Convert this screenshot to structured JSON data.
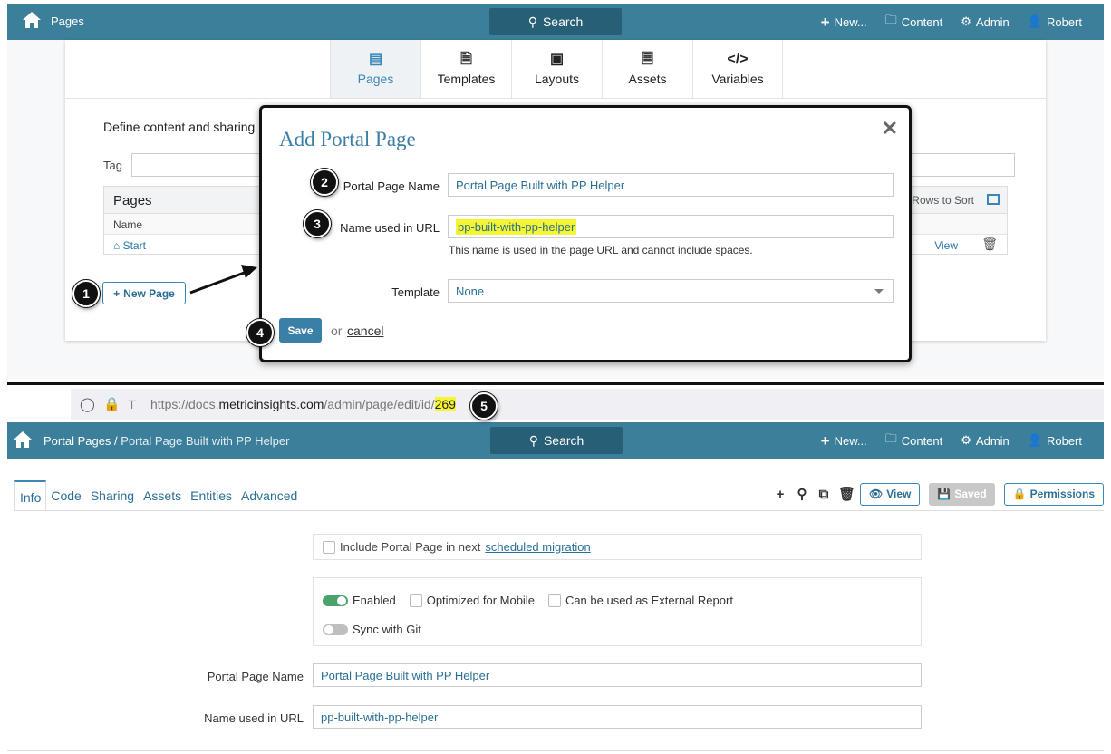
{
  "top": {
    "breadcrumb": "Pages",
    "search_label": "Search",
    "nav": {
      "new": "New...",
      "content": "Content",
      "admin": "Admin",
      "user": "Robert"
    },
    "tabs": [
      {
        "label": "Pages",
        "icon": "pages-icon",
        "active": true
      },
      {
        "label": "Templates",
        "icon": "templates-icon"
      },
      {
        "label": "Layouts",
        "icon": "layouts-icon"
      },
      {
        "label": "Assets",
        "icon": "assets-icon"
      },
      {
        "label": "Variables",
        "icon": "variables-icon"
      }
    ],
    "define_text": "Define content and sharing",
    "tag_label": "Tag",
    "table": {
      "title": "Pages",
      "rows_to_sort": "Rows to Sort",
      "col_name": "Name",
      "row_start": "Start",
      "row_view": "View"
    },
    "new_page_button": "New Page"
  },
  "modal": {
    "title": "Add Portal Page",
    "portal_page_name_label": "Portal Page Name",
    "portal_page_name_value": "Portal Page Built with PP Helper",
    "url_name_label": "Name used in URL",
    "url_name_value": "pp-built-with-pp-helper",
    "url_hint": "This name is used in the page URL and cannot include spaces.",
    "template_label": "Template",
    "template_value": "None",
    "save_label": "Save",
    "or_text": "or",
    "cancel_label": "cancel"
  },
  "callouts": [
    "1",
    "2",
    "3",
    "4",
    "5"
  ],
  "browser": {
    "url_prefix": "https://docs.",
    "url_host": "metricinsights.com",
    "url_path": "/admin/page/edit/id/",
    "url_id": "269"
  },
  "bottom": {
    "breadcrumb_root": "Portal Pages",
    "breadcrumb_sep": " / ",
    "breadcrumb_current": "Portal Page Built with PP Helper",
    "search_label": "Search",
    "nav": {
      "new": "New...",
      "content": "Content",
      "admin": "Admin",
      "user": "Robert"
    },
    "tabs": [
      "Info",
      "Code",
      "Sharing",
      "Assets",
      "Entities",
      "Advanced"
    ],
    "buttons": {
      "view": "View",
      "saved": "Saved",
      "permissions": "Permissions"
    },
    "migration_text": "Include Portal Page in next",
    "migration_link": "scheduled migration",
    "enabled_label": "Enabled",
    "optimized_label": "Optimized for Mobile",
    "external_label": "Can be used as External Report",
    "sync_label": "Sync with Git",
    "portal_page_name_label": "Portal Page Name",
    "portal_page_name_value": "Portal Page Built with PP Helper",
    "url_name_label": "Name used in URL",
    "url_name_value": "pp-built-with-pp-helper"
  },
  "colors": {
    "navbar": "#3c7f9a",
    "search": "#275f76",
    "accent": "#3a87b6",
    "highlight": "#f5f533",
    "enabled": "#4aa36b"
  }
}
